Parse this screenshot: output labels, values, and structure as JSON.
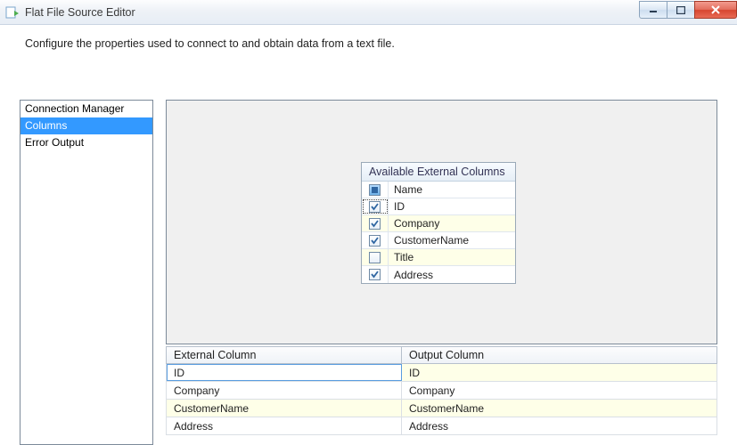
{
  "window": {
    "title": "Flat File Source Editor"
  },
  "description": "Configure the properties used to connect to and obtain data from a text file.",
  "sidebar": {
    "items": [
      {
        "label": "Connection Manager",
        "selected": false
      },
      {
        "label": "Columns",
        "selected": true
      },
      {
        "label": "Error Output",
        "selected": false
      }
    ]
  },
  "available": {
    "title": "Available External Columns",
    "name_header": "Name",
    "rows": [
      {
        "label": "ID",
        "checked": true,
        "focused": true
      },
      {
        "label": "Company",
        "checked": true
      },
      {
        "label": "CustomerName",
        "checked": true
      },
      {
        "label": "Title",
        "checked": false
      },
      {
        "label": "Address",
        "checked": true
      }
    ]
  },
  "mapping": {
    "col_external": "External Column",
    "col_output": "Output Column",
    "rows": [
      {
        "external": "ID",
        "output": "ID",
        "selected": true
      },
      {
        "external": "Company",
        "output": "Company"
      },
      {
        "external": "CustomerName",
        "output": "CustomerName"
      },
      {
        "external": "Address",
        "output": "Address"
      }
    ]
  }
}
